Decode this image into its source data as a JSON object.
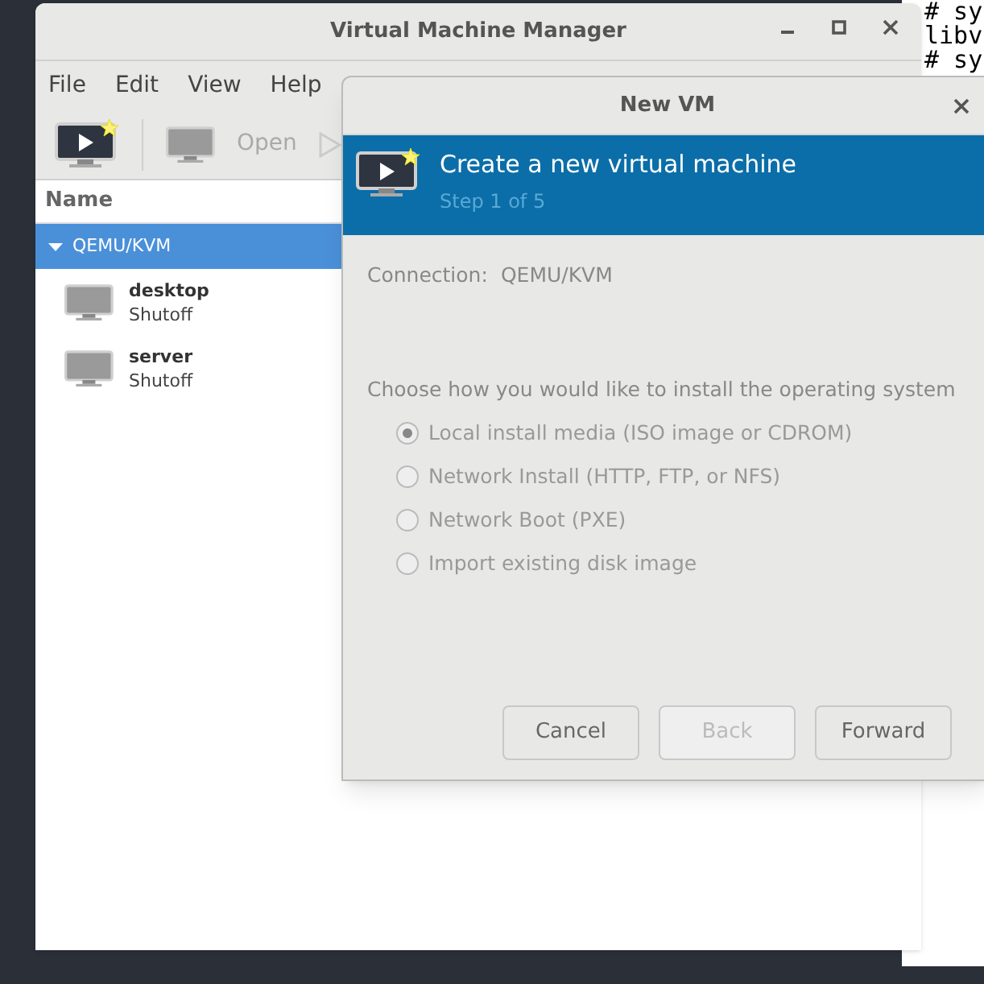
{
  "terminal": {
    "lines": [
      "# sy",
      "libv",
      "# sy"
    ]
  },
  "main_window": {
    "title": "Virtual Machine Manager",
    "menu": [
      "File",
      "Edit",
      "View",
      "Help"
    ],
    "toolbar": {
      "open_label": "Open"
    },
    "list_header": "Name",
    "connection": {
      "label": "QEMU/KVM",
      "expanded": true,
      "selected": true
    },
    "vms": [
      {
        "name": "desktop",
        "status": "Shutoff"
      },
      {
        "name": "server",
        "status": "Shutoff"
      }
    ]
  },
  "dialog": {
    "title": "New VM",
    "heading": "Create a new virtual machine",
    "step": "Step 1 of 5",
    "connection_label": "Connection:",
    "connection_value": "QEMU/KVM",
    "prompt": "Choose how you would like to install the operating system",
    "options": [
      {
        "label": "Local install media (ISO image or CDROM)",
        "selected": true
      },
      {
        "label": "Network Install (HTTP, FTP, or NFS)",
        "selected": false
      },
      {
        "label": "Network Boot (PXE)",
        "selected": false
      },
      {
        "label": "Import existing disk image",
        "selected": false
      }
    ],
    "buttons": [
      {
        "label": "Cancel",
        "disabled": false
      },
      {
        "label": "Back",
        "disabled": true
      },
      {
        "label": "Forward",
        "disabled": false
      }
    ]
  }
}
